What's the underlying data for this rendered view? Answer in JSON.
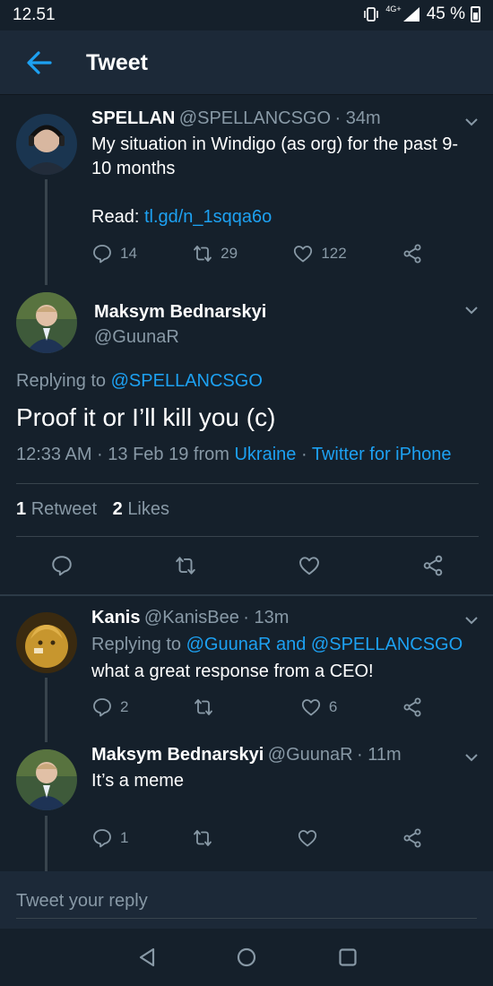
{
  "status": {
    "time": "12.51",
    "network": "4G+",
    "battery": "45 %"
  },
  "header": {
    "title": "Tweet",
    "back_icon": "arrow-left-icon"
  },
  "colors": {
    "background": "#15202b",
    "header": "#1c2938",
    "accent": "#1da1f2",
    "muted": "#8899a6",
    "divider": "#38444d"
  },
  "parent_tweet": {
    "name": "SPELLAN",
    "handle": "@SPELLANCSGO",
    "time": "· 34m",
    "text": "My situation in Windigo (as org) for the past 9-10 months",
    "read_label": "Read:",
    "read_link": "tl.gd/n_1sqqa6o",
    "replies": "14",
    "retweets": "29",
    "likes": "122"
  },
  "main_tweet": {
    "name": "Maksym Bednarskyi",
    "handle": "@GuunaR",
    "replying_label": "Replying to",
    "replying_to": "@SPELLANCSGO",
    "text": "Proof it or I’ll kill you (c)",
    "timestamp": "12:33 AM · 13 Feb 19 from",
    "location": "Ukraine",
    "separator": "·",
    "client": "Twitter for iPhone",
    "retweet_count": "1",
    "retweet_label": "Retweet",
    "like_count": "2",
    "like_label": "Likes"
  },
  "replies": [
    {
      "name": "Kanis",
      "handle": "@KanisBee",
      "time": "· 13m",
      "replying_label": "Replying to",
      "replying_to_1": "@GuunaR",
      "and_label": "and",
      "replying_to_2": "@SPELLANCSGO",
      "text": "what a great response from a CEO!",
      "replies": "2",
      "likes": "6"
    },
    {
      "name": "Maksym Bednarskyi",
      "handle": "@GuunaR",
      "time": "· 11m",
      "text": "It’s a meme",
      "replies": "1"
    }
  ],
  "reply_bar": {
    "placeholder": "Tweet your reply"
  },
  "navbar": {
    "icons": [
      "nav-back-icon",
      "nav-home-icon",
      "nav-recents-icon"
    ]
  }
}
